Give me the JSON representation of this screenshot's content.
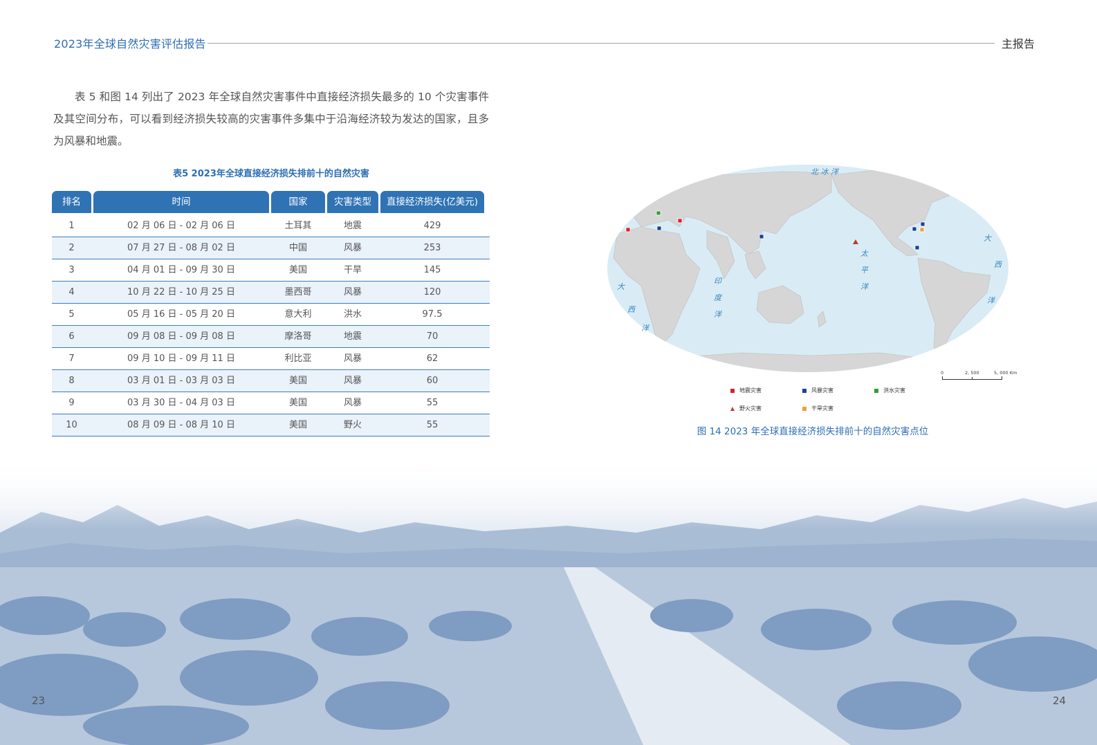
{
  "header": {
    "title": "2023年全球自然灾害评估报告",
    "section": "主报告"
  },
  "paragraph": "表 5 和图 14 列出了 2023 年全球自然灾害事件中直接经济损失最多的 10 个灾害事件及其空间分布，可以看到经济损失较高的灾害事件多集中于沿海经济较为发达的国家，且多为风暴和地震。",
  "table": {
    "caption": "表5  2023年全球直接经济损失排前十的自然灾害",
    "headers": [
      "排名",
      "时间",
      "国家",
      "灾害类型",
      "直接经济损失(亿美元)"
    ],
    "rows": [
      [
        "1",
        "02 月 06 日 - 02 月 06 日",
        "土耳其",
        "地震",
        "429"
      ],
      [
        "2",
        "07 月 27 日 - 08 月 02 日",
        "中国",
        "风暴",
        "253"
      ],
      [
        "3",
        "04 月 01 日 - 09 月 30 日",
        "美国",
        "干旱",
        "145"
      ],
      [
        "4",
        "10 月 22 日 - 10 月 25 日",
        "墨西哥",
        "风暴",
        "120"
      ],
      [
        "5",
        "05 月 16 日 - 05 月 20 日",
        "意大利",
        "洪水",
        "97.5"
      ],
      [
        "6",
        "09 月 08 日 - 09 月 08 日",
        "摩洛哥",
        "地震",
        "70"
      ],
      [
        "7",
        "09 月 10 日 - 09 月 11 日",
        "利比亚",
        "风暴",
        "62"
      ],
      [
        "8",
        "03 月 01 日 - 03 月 03 日",
        "美国",
        "风暴",
        "60"
      ],
      [
        "9",
        "03 月 30 日 - 04 月 03 日",
        "美国",
        "风暴",
        "55"
      ],
      [
        "10",
        "08 月 09 日 - 08 月 10 日",
        "美国",
        "野火",
        "55"
      ]
    ]
  },
  "map": {
    "ocean_labels": {
      "arctic": "北 冰 洋",
      "atlantic_left": [
        "大",
        "西",
        "洋"
      ],
      "indian": [
        "印",
        "度",
        "洋"
      ],
      "pacific": [
        "太",
        "平",
        "洋"
      ],
      "atlantic_right": [
        "大",
        "西",
        "洋"
      ]
    },
    "scale": {
      "labels": [
        "0",
        "2, 500",
        "5, 000 Km"
      ]
    },
    "legend": [
      "地震灾害",
      "风暴灾害",
      "洪水灾害",
      "野火灾害",
      "干旱灾害"
    ],
    "colors": {
      "earthquake": "#d8232a",
      "storm": "#1f3f9a",
      "flood": "#3a9a3a",
      "wildfire": "#c0392b",
      "drought": "#e8a23a",
      "ocean": "#d9ecf5",
      "land": "#d6d6d6"
    }
  },
  "figure_caption": "图 14  2023 年全球直接经济损失排前十的自然灾害点位",
  "page_numbers": {
    "left": "23",
    "right": "24"
  }
}
